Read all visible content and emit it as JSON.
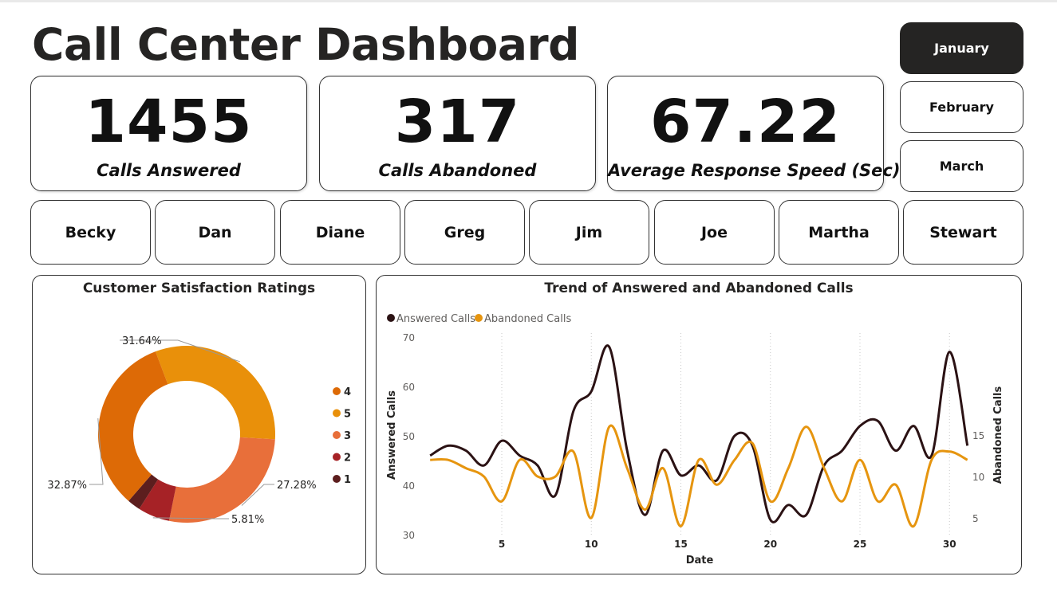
{
  "header": {
    "title": "Call Center Dashboard"
  },
  "kpis": [
    {
      "value": "1455",
      "label": "Calls Answered"
    },
    {
      "value": "317",
      "label": "Calls Abandoned"
    },
    {
      "value": "67.22",
      "label": "Average Response Speed (Sec)"
    }
  ],
  "months": {
    "selected": "January",
    "items": [
      "January",
      "February",
      "March"
    ]
  },
  "agents": [
    "Becky",
    "Dan",
    "Diane",
    "Greg",
    "Jim",
    "Joe",
    "Martha",
    "Stewart"
  ],
  "colors": {
    "dark": "#2b1214",
    "orange": "#e6950f",
    "selected_bg": "#252423"
  },
  "satisfaction": {
    "title": "Customer Satisfaction Ratings",
    "slices": [
      {
        "label": "5",
        "percent": 31.64,
        "display": "31.64%",
        "color": "#e9900a"
      },
      {
        "label": "3",
        "percent": 27.28,
        "display": "27.28%",
        "color": "#e86f3a"
      },
      {
        "label": "2",
        "percent": 5.81,
        "display": "5.81%",
        "color": "#a62226"
      },
      {
        "label": "1",
        "percent": 2.4,
        "display": "",
        "color": "#5c1e1e"
      },
      {
        "label": "4",
        "percent": 32.87,
        "display": "32.87%",
        "color": "#dd6a06"
      }
    ],
    "legend": [
      {
        "label": "4",
        "color": "#dd6a06"
      },
      {
        "label": "5",
        "color": "#e9900a"
      },
      {
        "label": "3",
        "color": "#e86f3a"
      },
      {
        "label": "2",
        "color": "#a62226"
      },
      {
        "label": "1",
        "color": "#5c1e1e"
      }
    ]
  },
  "trend": {
    "title": "Trend of Answered and Abandoned Calls",
    "legend": [
      {
        "label": "Answered Calls",
        "color": "#2b1214"
      },
      {
        "label": "Abandoned Calls",
        "color": "#e6950f"
      }
    ],
    "xlabel": "Date",
    "ylabel_left": "Answered Calls",
    "ylabel_right": "Abandoned Calls",
    "x_ticks": [
      "5",
      "10",
      "15",
      "20",
      "25",
      "30"
    ],
    "y_left_ticks": [
      "30",
      "40",
      "50",
      "60",
      "70"
    ],
    "y_right_ticks": [
      "5",
      "10",
      "15"
    ]
  },
  "chart_data": [
    {
      "type": "pie",
      "title": "Customer Satisfaction Ratings",
      "categories": [
        "5",
        "3",
        "2",
        "1",
        "4"
      ],
      "values": [
        31.64,
        27.28,
        5.81,
        2.4,
        32.87
      ],
      "legend": "right"
    },
    {
      "type": "line",
      "title": "Trend of Answered and Abandoned Calls",
      "xlabel": "Date",
      "ylabel": "Answered Calls",
      "y2label": "Abandoned Calls",
      "x": [
        1,
        2,
        3,
        4,
        5,
        6,
        7,
        8,
        9,
        10,
        11,
        12,
        13,
        14,
        15,
        16,
        17,
        18,
        19,
        20,
        21,
        22,
        23,
        24,
        25,
        26,
        27,
        28,
        29,
        30,
        31
      ],
      "series": [
        {
          "name": "Answered Calls",
          "axis": "left",
          "values": [
            46,
            48,
            47,
            44,
            49,
            46,
            44,
            38,
            55,
            59,
            68,
            47,
            34,
            47,
            42,
            44,
            41,
            50,
            48,
            33,
            36,
            34,
            44,
            47,
            52,
            53,
            47,
            52,
            46,
            67,
            48
          ]
        },
        {
          "name": "Abandoned Calls",
          "axis": "right",
          "values": [
            12,
            12,
            11,
            10,
            7,
            12,
            10,
            10,
            13,
            5,
            16,
            11,
            6,
            11,
            4,
            12,
            9,
            12,
            14,
            7,
            11,
            16,
            11,
            7,
            12,
            7,
            9,
            4,
            12,
            13,
            12
          ]
        }
      ],
      "ylim": [
        30,
        70
      ],
      "y2lim": [
        5,
        15
      ],
      "legend": "top-left",
      "grid": "vertical dotted"
    }
  ]
}
